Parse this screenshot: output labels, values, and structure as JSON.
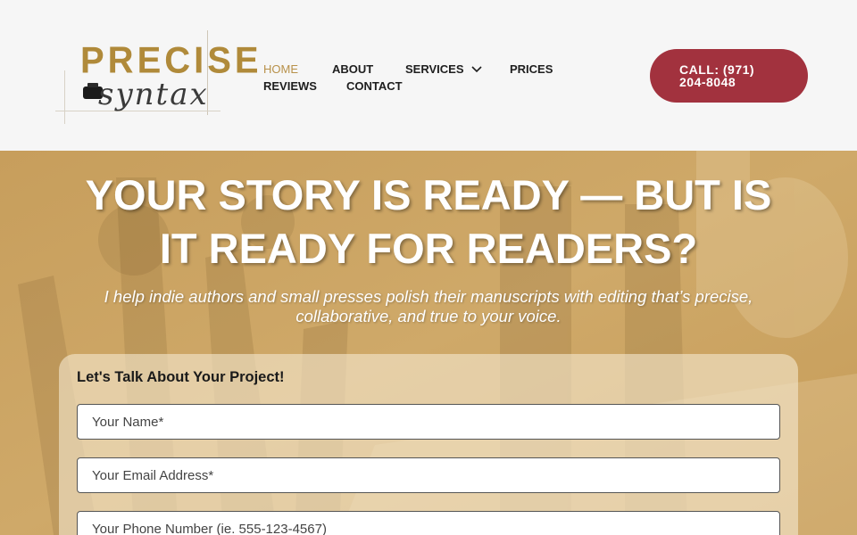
{
  "logo": {
    "word": "PRECISE",
    "script": "syntax"
  },
  "nav": {
    "row1": [
      {
        "label": "HOME",
        "active": true
      },
      {
        "label": "ABOUT"
      },
      {
        "label": "SERVICES",
        "has_dropdown": true
      },
      {
        "label": "PRICES"
      }
    ],
    "row2": [
      {
        "label": "REVIEWS"
      },
      {
        "label": "CONTACT"
      }
    ]
  },
  "call_button": {
    "line1": "CALL: (971)",
    "line2": "204-8048"
  },
  "hero": {
    "headline_line1": "YOUR STORY IS READY — BUT IS",
    "headline_line2": "IT READY FOR READERS?",
    "subtitle_line1": "I help indie authors and small presses polish their manuscripts with editing that’s precise,",
    "subtitle_line2": "collaborative, and true to your voice."
  },
  "form": {
    "title": "Let's Talk About Your Project!",
    "name_placeholder": "Your Name*",
    "email_placeholder": "Your Email Address*",
    "phone_placeholder": "Your Phone Number (ie. 555-123-4567)"
  },
  "colors": {
    "accent_gold": "#b8914a",
    "call_button": "#a2323e",
    "hero_overlay": "#c9a15f"
  }
}
